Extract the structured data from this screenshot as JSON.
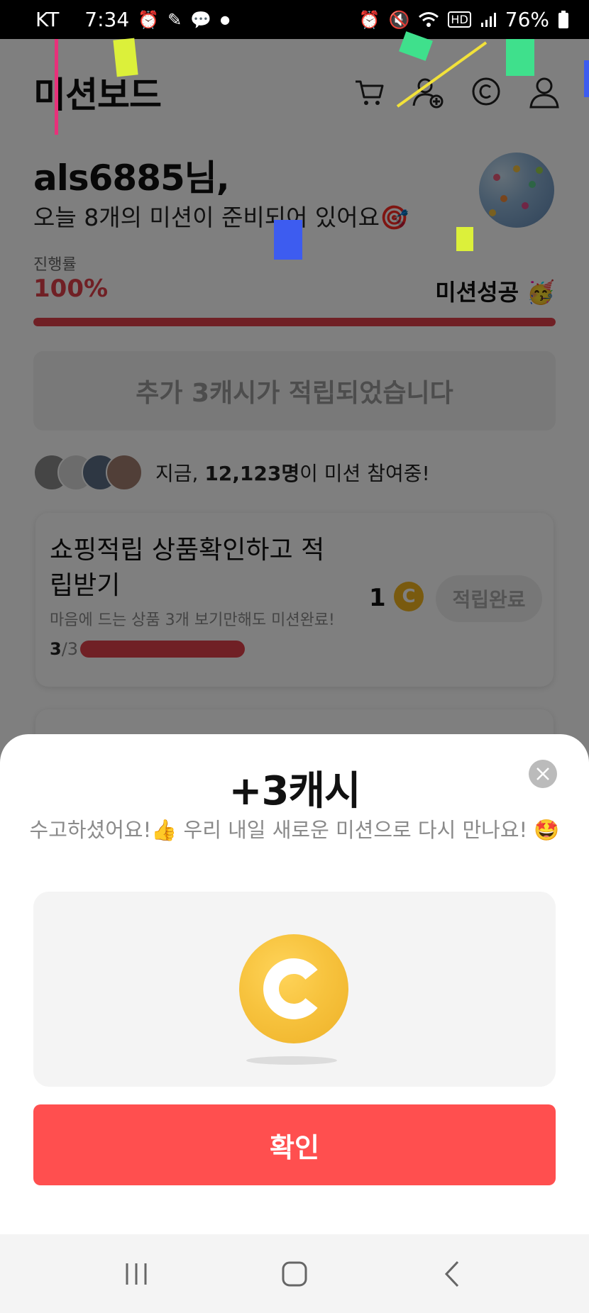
{
  "status_bar": {
    "carrier": "KT",
    "time": "7:34",
    "battery": "76%",
    "left_icons": [
      "alarm-icon",
      "feather-icon",
      "chat-bubble-icon",
      "dot-icon"
    ],
    "right_icons": [
      "alarm-icon",
      "mute-icon",
      "wifi-icon",
      "hd-icon",
      "signal-icon",
      "battery-icon"
    ]
  },
  "header": {
    "title": "미션보드",
    "icons": [
      "cart-icon",
      "add-user-icon",
      "cash-coin-icon",
      "user-icon"
    ]
  },
  "greeting": {
    "name": "als6885님,",
    "subtitle": "오늘 8개의 미션이 준비되어 있어요🎯"
  },
  "progress": {
    "label": "진행률",
    "value": "100%",
    "fraction": 1.0,
    "status": "미션성공 🥳"
  },
  "banner": {
    "text": "추가 3캐시가 적립되었습니다"
  },
  "participants": {
    "prefix": "지금, ",
    "count": "12,123명",
    "suffix": "이 미션 참여중!"
  },
  "mission_card": {
    "title": "쇼핑적립 상품확인하고 적립받기",
    "description": "마음에 드는 상품 3개 보기만해도 미션완료!",
    "done": "3",
    "total": "/3",
    "reward": "1",
    "button_label": "적립완료"
  },
  "modal": {
    "title": "+3캐시",
    "message": "수고하셨어요!👍 우리 내일 새로운 미션으로 다시 만나요! 🤩",
    "confirm_label": "확인"
  },
  "colors": {
    "accent_red": "#ff4f4f",
    "progress_red": "#e0404a",
    "coin_gold": "#f7c33e"
  }
}
